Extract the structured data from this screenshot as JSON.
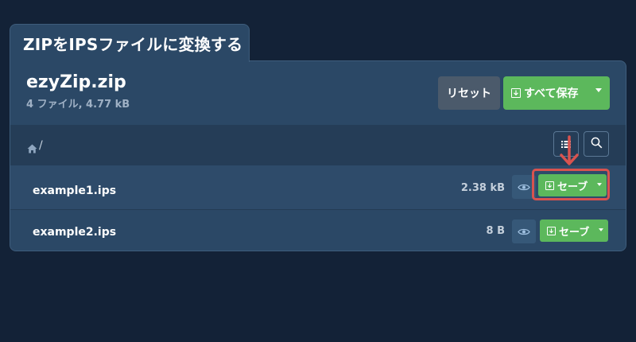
{
  "tab": {
    "title": "ZIPをIPSファイルに変換する"
  },
  "archive": {
    "name": "ezyZip.zip",
    "summary": "4 ファイル, 4.77 kB"
  },
  "actions": {
    "reset_label": "リセット",
    "save_all_label": "すべて保存"
  },
  "breadcrumb": {
    "separator": "/"
  },
  "files": [
    {
      "name": "example1.ips",
      "size": "2.38 kB",
      "save_label": "セーブ"
    },
    {
      "name": "example2.ips",
      "size": "8 B",
      "save_label": "セーブ"
    }
  ],
  "colors": {
    "background": "#132237",
    "panel": "#2b4866",
    "accent_green": "#5cb85c",
    "highlight_red": "#d9534f"
  },
  "icons": [
    "home-icon",
    "list-icon",
    "search-icon",
    "eye-icon",
    "download-icon",
    "caret-down-icon",
    "arrow-down-icon"
  ]
}
